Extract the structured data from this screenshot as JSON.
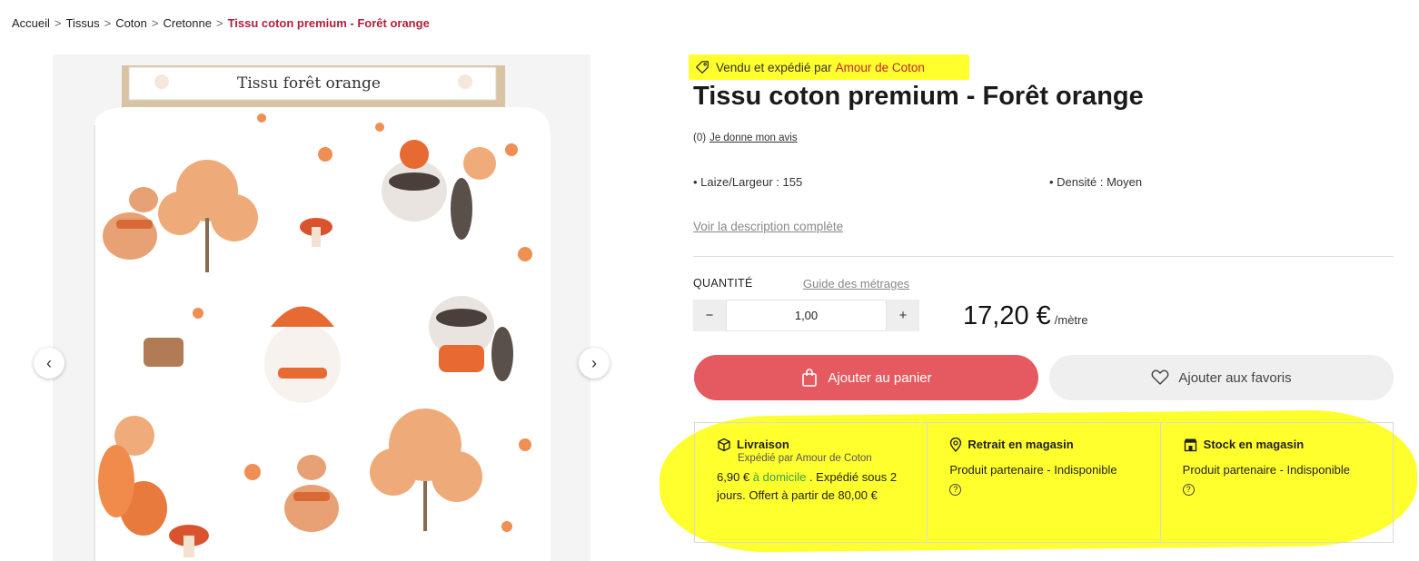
{
  "breadcrumb": {
    "items": [
      "Accueil",
      "Tissus",
      "Coton",
      "Cretonne"
    ],
    "current": "Tissu coton premium - Forêt orange",
    "separator": ">"
  },
  "gallery": {
    "label_text": "Tissu forêt orange",
    "prev_icon": "chevron-left-icon",
    "next_icon": "chevron-right-icon",
    "prev_glyph": "‹",
    "next_glyph": "›"
  },
  "seller": {
    "prefix": "Vendu et expédié par",
    "name": "Amour de Coton"
  },
  "product": {
    "title": "Tissu coton premium - Forêt orange",
    "review_count": "(0)",
    "review_link": "Je donne mon avis",
    "specs": [
      "• Laize/Largeur : 155",
      "• Densité : Moyen"
    ],
    "description_link": "Voir la description complète"
  },
  "quantity": {
    "label": "QUANTITÉ",
    "guide_link": "Guide des métrages",
    "value": "1,00",
    "minus": "−",
    "plus": "+"
  },
  "price": {
    "amount": "17,20 €",
    "unit": "/mètre"
  },
  "actions": {
    "cart_label": "Ajouter au panier",
    "favorite_label": "Ajouter aux favoris"
  },
  "info": {
    "delivery": {
      "title": "Livraison",
      "subtitle": "Expédié par Amour de Coton",
      "price": "6,90 €",
      "mode": "à domicile",
      "text": ". Expédié sous 2 jours. Offert à partir de 80,00 €"
    },
    "pickup": {
      "title": "Retrait en magasin",
      "text": "Produit partenaire - Indisponible",
      "help": "?"
    },
    "stock": {
      "title": "Stock en magasin",
      "text": "Produit partenaire - Indisponible",
      "help": "?"
    }
  },
  "colors": {
    "accent": "#b0213a",
    "cart_button": "#e55a60",
    "highlight": "#ffff2e",
    "fabric_orange": "#e8854a",
    "delivery_green": "#3aa14a"
  }
}
